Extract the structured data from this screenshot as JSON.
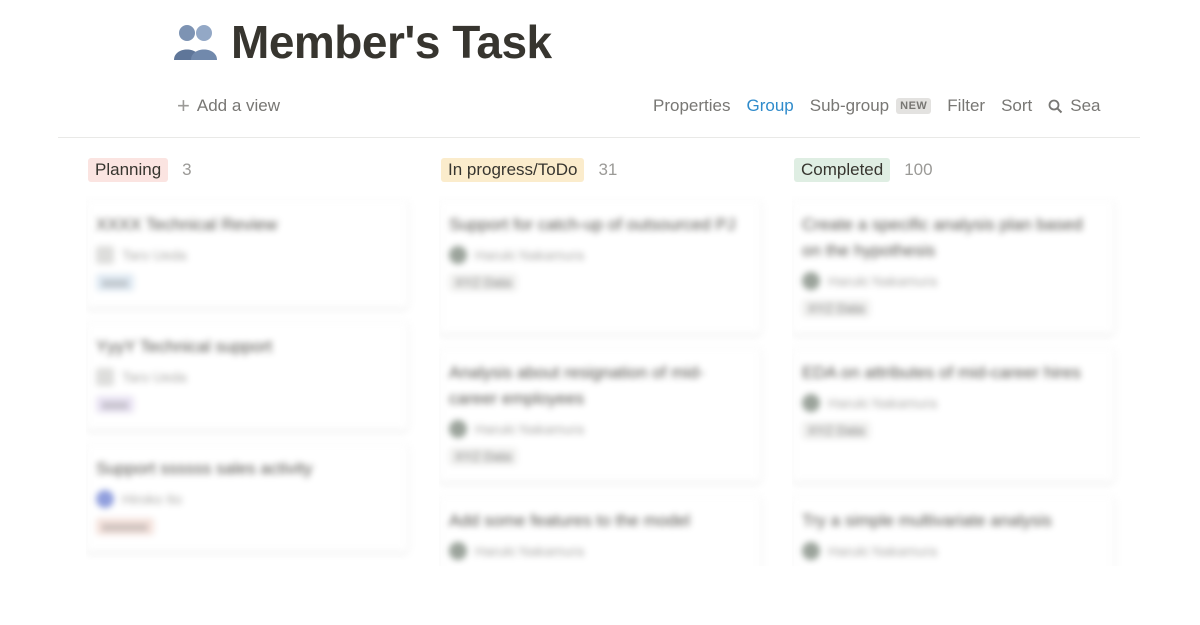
{
  "page": {
    "icon": "two-people-icon",
    "title": "Member's Task"
  },
  "toolbar": {
    "add_view": "Add a view",
    "properties": "Properties",
    "group": "Group",
    "subgroup": "Sub-group",
    "new_badge": "NEW",
    "filter": "Filter",
    "sort": "Sort",
    "search": "Sea",
    "active_color": "#2f8bcb"
  },
  "board": {
    "columns": [
      {
        "status": "Planning",
        "count": "3",
        "tag_color": "#fbe4e1",
        "cards": [
          {
            "title": "XXXX Technical Review",
            "person": "Taro Ueda",
            "tag": "xxxx",
            "tag_color": "#dbe7f2"
          },
          {
            "title": "YyyY Technical support",
            "person": "Taro Ueda",
            "tag": "xxxx",
            "tag_color": "#e6dff2"
          },
          {
            "title": "Support ssssss sales activity",
            "person": "Hiroko Ito",
            "tag": "xxxxxxx",
            "tag_color": "#f4dfd8"
          }
        ]
      },
      {
        "status": "In progress/ToDo",
        "count": "31",
        "tag_color": "#fbeccc",
        "cards": [
          {
            "title": "Support for catch-up of outsourced PJ",
            "person": "Haruki Nakamura",
            "tag": "XYZ Data",
            "tag_color": "#ececea"
          },
          {
            "title": "Analysis about resignation of mid-career employees",
            "person": "Haruki Nakamura",
            "tag": "XYZ Data",
            "tag_color": "#ececea"
          },
          {
            "title": "Add some features to the model",
            "person": "Haruki Nakamura",
            "tag": "",
            "tag_color": "#ececea"
          }
        ]
      },
      {
        "status": "Completed",
        "count": "100",
        "tag_color": "#dfeee3",
        "cards": [
          {
            "title": "Create a specific analysis plan based on the hypothesis",
            "person": "Haruki Nakamura",
            "tag": "XYZ Data",
            "tag_color": "#ececea"
          },
          {
            "title": "EDA on attributes of mid-career hires",
            "person": "Haruki Nakamura",
            "tag": "XYZ Data",
            "tag_color": "#ececea"
          },
          {
            "title": "Try a simple multivariate analysis",
            "person": "Haruki Nakamura",
            "tag": "",
            "tag_color": "#ececea"
          }
        ]
      }
    ]
  }
}
